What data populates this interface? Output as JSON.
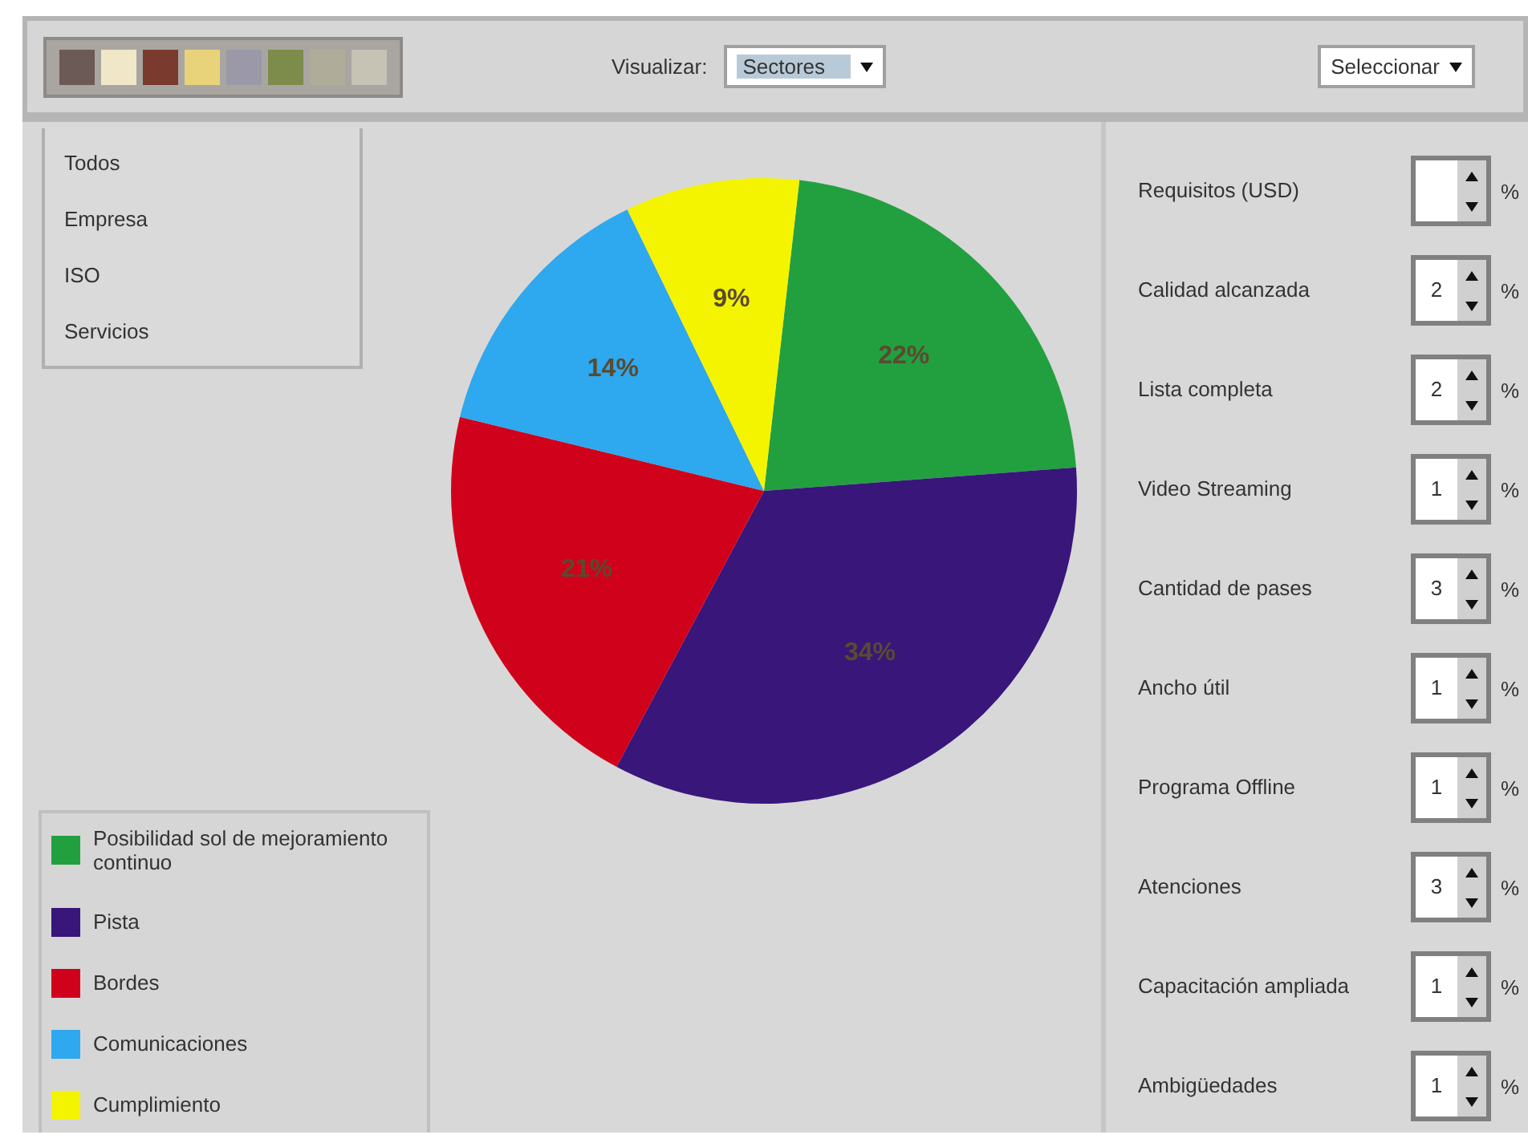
{
  "toolbar": {
    "view_label": "Visualizar:",
    "view_select": "Sectores",
    "filter_select": "Seleccionar"
  },
  "filter_list": {
    "items": [
      {
        "label": "Todos",
        "selected": false
      },
      {
        "label": "Empresa",
        "selected": false
      },
      {
        "label": "ISO",
        "selected": false
      },
      {
        "label": "Servicios",
        "selected": false
      }
    ]
  },
  "chart": {
    "chart_data": {
      "type": "pie",
      "categories": [
        "Posibilidad sol de mejoramiento continuo",
        "Pista",
        "Bordes",
        "Comunicaciones",
        "Cumplimiento"
      ],
      "values": [
        22,
        34,
        21,
        14,
        9
      ],
      "data_labels": true,
      "value_labels": [
        "22%",
        "34%",
        "21%",
        "14%",
        "9%"
      ]
    }
  },
  "legend": [
    {
      "color": "#22a040"
    },
    {
      "color": "#38167a"
    },
    {
      "color": "#d0021b"
    },
    {
      "color": "#2ea8ee"
    },
    {
      "color": "#f4f400"
    }
  ],
  "criteria": [
    {
      "label": "Requisitos (USD)",
      "unit": "%"
    },
    {
      "label": "Calidad alcanzada",
      "value": "2",
      "unit": "%"
    },
    {
      "label": "Lista completa",
      "value": "2",
      "unit": "%"
    },
    {
      "label": "Video Streaming",
      "value": "1",
      "unit": "%"
    },
    {
      "label": "Cantidad de pases",
      "value": "3",
      "unit": "%"
    },
    {
      "label": "Ancho útil",
      "value": "1",
      "unit": "%"
    },
    {
      "label": "Programa Offline",
      "value": "1",
      "unit": "%"
    },
    {
      "label": "Atenciones",
      "value": "3",
      "unit": "%"
    },
    {
      "label": "Capacitación ampliada",
      "value": "1",
      "unit": "%"
    },
    {
      "label": "Ambigüedades",
      "value": "1",
      "unit": "%"
    }
  ]
}
